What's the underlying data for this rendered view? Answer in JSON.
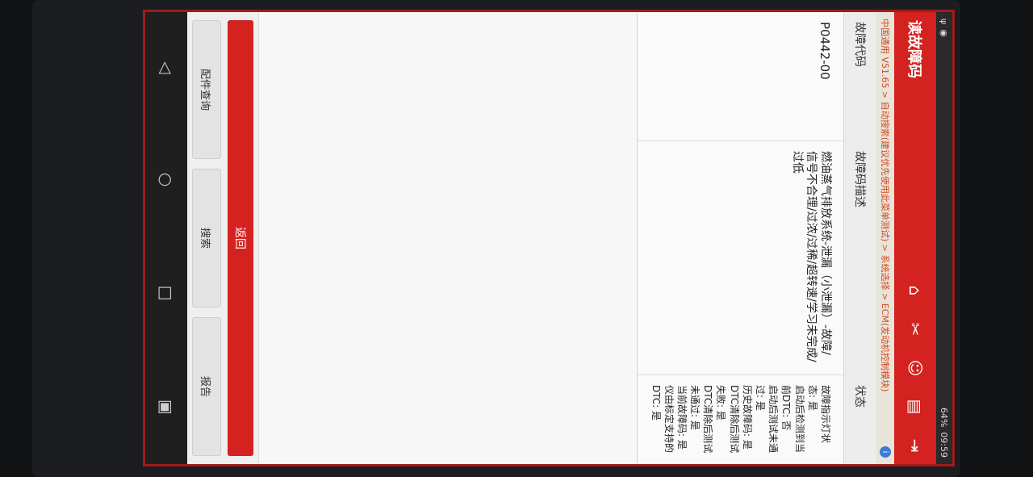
{
  "status_bar": {
    "left_icons": [
      "usb-icon",
      "record-icon"
    ],
    "time": "09:59",
    "battery": "64%"
  },
  "header": {
    "title": "读故障码",
    "icons": [
      "home-icon",
      "tools-icon",
      "user-icon",
      "print-icon",
      "exit-icon"
    ]
  },
  "breadcrumb": "中国通用 V51.65 > 自动搜索(建议优先使用此菜单测试) > 系统选择 > ECM(发动机控制模块)",
  "table": {
    "columns": [
      "故障代码",
      "故障码描述",
      "状态"
    ],
    "rows": [
      {
        "code": "P0442-00",
        "description": "燃油蒸气排放系统-泄漏（小泄漏）-故障/信号不合理/过浓/过稀/超转速/学习未完成/过低",
        "status": [
          "故障指示灯状态: 是",
          "启动后检测到当前DTC: 否",
          "启动后测试未通过: 是",
          "历史故障码: 是",
          "DTC清除后测试失败: 是",
          "DTC清除后测试未通过: 是",
          "当前故障码: 是",
          "仪由标定支持的DTC: 是"
        ]
      }
    ]
  },
  "buttons": {
    "back": "返回",
    "parts": "配件查询",
    "search": "搜索",
    "report": "报告"
  },
  "colors": {
    "accent": "#d3221f",
    "breadcrumb_text": "#d04a1e"
  }
}
